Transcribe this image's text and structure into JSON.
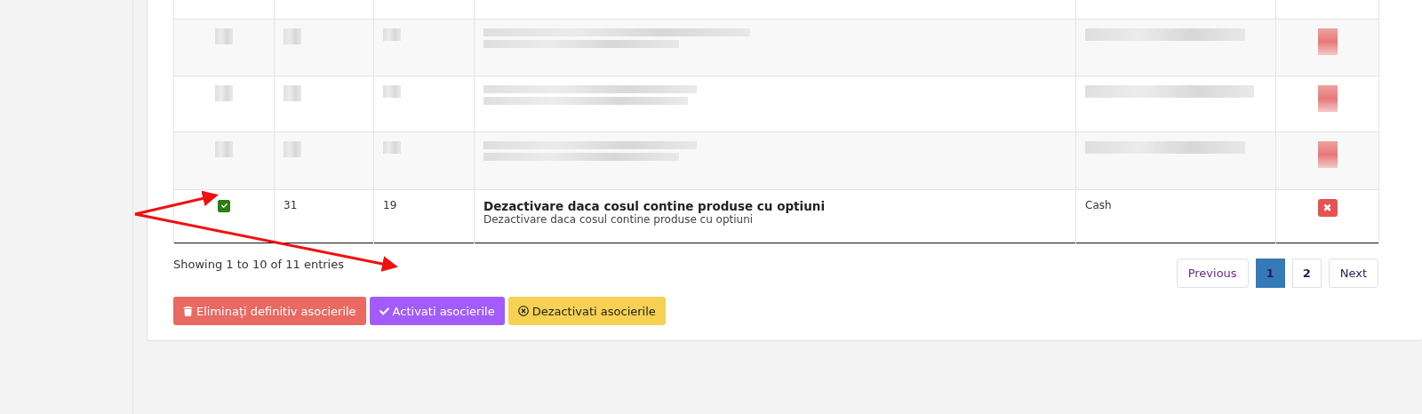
{
  "table": {
    "rows": [
      {
        "kind": "partial"
      },
      {
        "kind": "redacted"
      },
      {
        "kind": "redacted"
      },
      {
        "kind": "redacted"
      },
      {
        "kind": "entry",
        "checked": true,
        "column_2": "31",
        "column_3": "19",
        "title": "Dezactivare daca cosul contine produse cu optiuni",
        "description": "Dezactivare daca cosul contine produse cu optiuni",
        "column_5": "Cash",
        "delete_icon": "✖"
      }
    ]
  },
  "info": "Showing 1 to 10 of 11 entries",
  "pagination": [
    {
      "label": "Previous",
      "kind": "nav",
      "selected": false
    },
    {
      "label": "1",
      "kind": "page",
      "selected": true
    },
    {
      "label": "2",
      "kind": "page",
      "selected": false
    },
    {
      "label": "Next",
      "kind": "nav",
      "selected": false
    }
  ],
  "actions": [
    {
      "kind": "delete",
      "label": "Eliminați definitiv asocierile"
    },
    {
      "kind": "activate",
      "label": "Activati asocierile"
    },
    {
      "kind": "deactivate",
      "label": "Dezactivati asocierile"
    }
  ],
  "annotations": [
    {
      "kind": "arrow"
    },
    {
      "kind": "arrow"
    }
  ]
}
